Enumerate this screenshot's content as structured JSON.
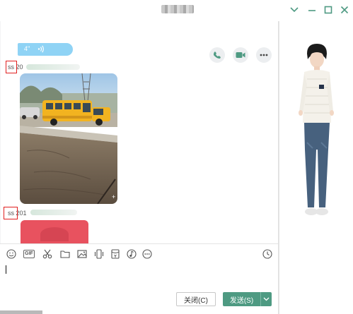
{
  "titlebar": {
    "icons": [
      "chevron-down-icon",
      "minimize-icon",
      "maximize-icon",
      "close-icon"
    ]
  },
  "header_actions": [
    "phone-icon",
    "video-icon",
    "more-icon"
  ],
  "messages": {
    "voice_duration": "4\"",
    "sender_1": "ss 20",
    "sender_2": "ss 201"
  },
  "toolbar": {
    "icons": [
      "emoji-icon",
      "gif-icon",
      "scissors-icon",
      "folder-icon",
      "image-icon",
      "shake-icon",
      "red-packet-icon",
      "music-icon",
      "more-icon",
      "history-icon"
    ],
    "gif_label": "GIF"
  },
  "buttons": {
    "close_label": "关闭(C)",
    "send_label": "发送(S)"
  },
  "colors": {
    "send_button": "#4e9a82",
    "voice_bubble": "#8fd3f5",
    "highlight_box": "#e02020",
    "red_packet": "#e8525f"
  }
}
